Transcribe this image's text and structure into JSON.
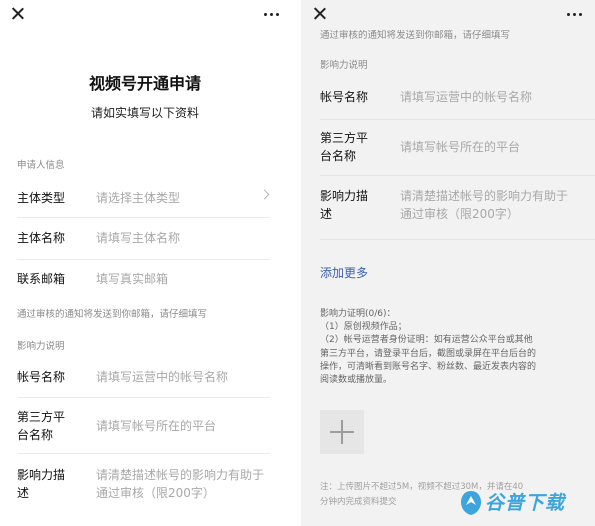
{
  "left": {
    "title": "视频号开通申请",
    "subtitle": "请如实填写以下资料",
    "section_applicant": "申请人信息",
    "rows": [
      {
        "label": "主体类型",
        "placeholder": "请选择主体类型"
      },
      {
        "label": "主体名称",
        "placeholder": "请填写主体名称"
      },
      {
        "label": "联系邮箱",
        "placeholder": "填写真实邮箱"
      }
    ],
    "email_hint": "通过审核的通知将发送到你邮箱，请仔细填写",
    "section_influence": "影响力说明",
    "influence_rows": [
      {
        "label": "帐号名称",
        "placeholder": "请填写运营中的帐号名称"
      },
      {
        "label_line1": "第三方平",
        "label_line2": "台名称",
        "placeholder": "请填写帐号所在的平台"
      },
      {
        "label_line1": "影响力描",
        "label_line2": "述",
        "placeholder_line1": "请清楚描述帐号的影响力有助于",
        "placeholder_line2": "通过审核（限200字）"
      }
    ]
  },
  "right": {
    "top_hint": "通过审核的通知将发送到你邮箱，请仔细填写",
    "section_influence": "影响力说明",
    "influence_rows": [
      {
        "label": "帐号名称",
        "placeholder": "请填写运营中的帐号名称"
      },
      {
        "label_line1": "第三方平",
        "label_line2": "台名称",
        "placeholder": "请填写帐号所在的平台"
      },
      {
        "label_line1": "影响力描",
        "label_line2": "述",
        "placeholder_line1": "请清楚描述帐号的影响力有助于",
        "placeholder_line2": "通过审核（限200字）"
      }
    ],
    "add_more": "添加更多",
    "proof_lines": [
      "影响力证明(0/6)：",
      "（1）原创视频作品；",
      "（2）帐号运营者身份证明：如有运营公众平台或其他",
      "第三方平台，请登录平台后，截图或录屏在平台后台的",
      "操作，可清晰看到账号名字、粉丝数、最近发表内容的",
      "阅读数或播放量。"
    ],
    "note_lines": [
      "注：上传图片不超过5M，视频不超过30M，并请在40",
      "分钟内完成资料提交"
    ]
  },
  "icons": {
    "close": "close-icon",
    "more": "more-icon",
    "chevron": "chevron-right-icon",
    "upload": "plus-icon"
  },
  "watermark": {
    "text": "谷普下载",
    "color": "#3da5dc"
  }
}
